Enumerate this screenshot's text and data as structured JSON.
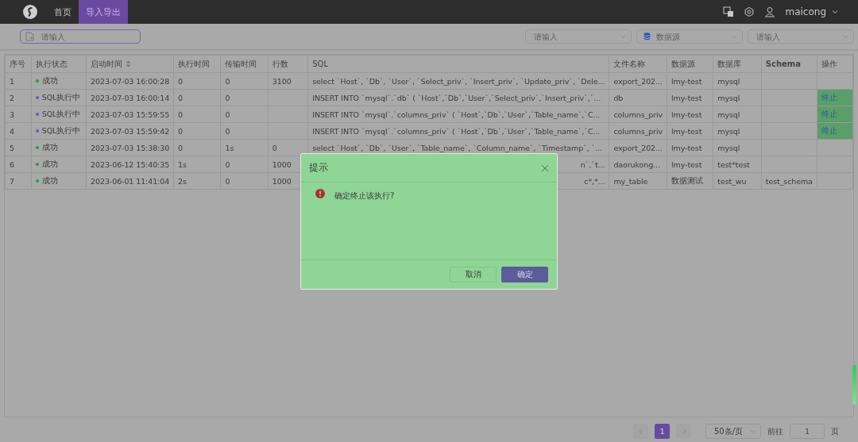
{
  "nav": {
    "items": [
      {
        "label": "首页",
        "selected": false
      },
      {
        "label": "导入导出",
        "selected": true
      }
    ],
    "user": "maicong"
  },
  "filters": {
    "file": {
      "placeholder": "请输入"
    },
    "selects": [
      {
        "placeholder": "请输入",
        "kind": "plain"
      },
      {
        "placeholder": "数据源",
        "kind": "database"
      },
      {
        "placeholder": "请输入",
        "kind": "plain"
      }
    ]
  },
  "table": {
    "columns": [
      {
        "label": "序号",
        "sortable": false
      },
      {
        "label": "执行状态",
        "sortable": false
      },
      {
        "label": "启动时间",
        "sortable": true
      },
      {
        "label": "执行时间",
        "sortable": false
      },
      {
        "label": "传输时间",
        "sortable": false
      },
      {
        "label": "行数",
        "sortable": false
      },
      {
        "label": "SQL",
        "sortable": false
      },
      {
        "label": "文件名称",
        "sortable": false
      },
      {
        "label": "数据源",
        "sortable": false
      },
      {
        "label": "数据库",
        "sortable": false
      },
      {
        "label": "Schema",
        "sortable": false
      },
      {
        "label": "操作",
        "sortable": false
      }
    ],
    "rows": [
      {
        "no": "1",
        "status": "成功",
        "color": "#1f9e3a",
        "start": "2023-07-03 16:00:28",
        "exec": "0",
        "transfer": "0",
        "rows": "3100",
        "sql": "select `Host`, `Db`, `User`, `Select_priv`, `Insert_priv`, `Update_priv`, `Dele...",
        "file": "export_202...",
        "source": "lmy-test",
        "database": "mysql",
        "schema": "",
        "action": ""
      },
      {
        "no": "2",
        "status": "SQL执行中",
        "color": "#7a4fc4",
        "start": "2023-07-03 16:00:14",
        "exec": "0",
        "transfer": "0",
        "rows": "",
        "sql": "INSERT INTO `mysql`.`db` ( `Host`,`Db`,`User`,`Select_priv`,`Insert_priv`,`...",
        "file": "db",
        "source": "lmy-test",
        "database": "mysql",
        "schema": "",
        "action": "终止"
      },
      {
        "no": "3",
        "status": "SQL执行中",
        "color": "#7a4fc4",
        "start": "2023-07-03 15:59:55",
        "exec": "0",
        "transfer": "0",
        "rows": "",
        "sql": "INSERT INTO `mysql`.`columns_priv` ( `Host`,`Db`,`User`,`Table_name`,`C...",
        "file": "columns_priv",
        "source": "lmy-test",
        "database": "mysql",
        "schema": "",
        "action": "终止"
      },
      {
        "no": "4",
        "status": "SQL执行中",
        "color": "#7a4fc4",
        "start": "2023-07-03 15:59:42",
        "exec": "0",
        "transfer": "0",
        "rows": "",
        "sql": "INSERT INTO `mysql`.`columns_priv` ( `Host`,`Db`,`User`,`Table_name`,`C...",
        "file": "columns_priv",
        "source": "lmy-test",
        "database": "mysql",
        "schema": "",
        "action": "终止"
      },
      {
        "no": "5",
        "status": "成功",
        "color": "#1f9e3a",
        "start": "2023-07-03 15:38:30",
        "exec": "0",
        "transfer": "1s",
        "rows": "0",
        "sql": "select `Host`, `Db`, `User`, `Table_name`, `Column_name`, `Timestamp`, `...",
        "file": "export_202...",
        "source": "lmy-test",
        "database": "mysql",
        "schema": "",
        "action": ""
      },
      {
        "no": "6",
        "status": "成功",
        "color": "#1f9e3a",
        "start": "2023-06-12 15:40:35",
        "exec": "1s",
        "transfer": "0",
        "rows": "1000",
        "sql": "n`,`t...",
        "file": "daorukong...",
        "source": "lmy-test",
        "database": "test*test",
        "schema": "",
        "action": ""
      },
      {
        "no": "7",
        "status": "成功",
        "color": "#1f9e3a",
        "start": "2023-06-01 11:41:04",
        "exec": "2s",
        "transfer": "0",
        "rows": "1000",
        "sql": "c*,*...",
        "file": "my_table",
        "source": "数据测试",
        "database": "test_wu",
        "schema": "test_schema",
        "action": ""
      }
    ]
  },
  "pagination": {
    "pages": [
      {
        "label": "1",
        "selected": true
      }
    ],
    "page_size": "50条/页",
    "goto_label": "前往",
    "goto_value": "1",
    "page_unit": "页"
  },
  "dialog": {
    "title": "提示",
    "message": "确定终止该执行?",
    "buttons": [
      {
        "label": "取消",
        "kind": "secondary"
      },
      {
        "label": "确定",
        "kind": "primary"
      }
    ]
  }
}
